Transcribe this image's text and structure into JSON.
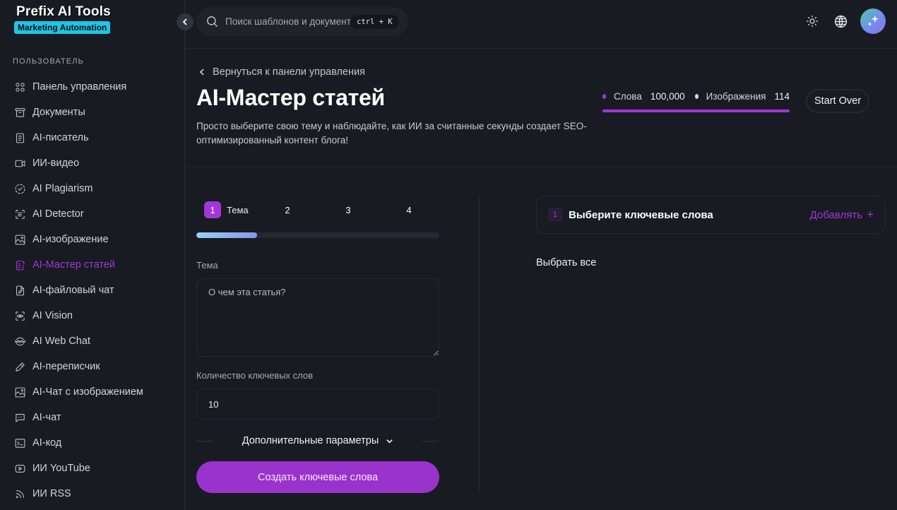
{
  "brand": {
    "title": "Prefix AI Tools",
    "badge": "Marketing Automation",
    "badge_color": "#1ec5e6"
  },
  "sidebar": {
    "section_label": "ПОЛЬЗОВАТЕЛЬ",
    "items": [
      {
        "label": "Панель управления",
        "icon": "dashboard-grid-icon",
        "active": false
      },
      {
        "label": "Документы",
        "icon": "archive-box-icon",
        "active": false
      },
      {
        "label": "AI-писатель",
        "icon": "document-text-icon",
        "active": false
      },
      {
        "label": "ИИ-видео",
        "icon": "video-camera-icon",
        "active": false
      },
      {
        "label": "AI Plagiarism",
        "icon": "dashed-check-circle-icon",
        "active": false
      },
      {
        "label": "AI Detector",
        "icon": "scan-text-icon",
        "active": false
      },
      {
        "label": "AI-изображение",
        "icon": "image-icon",
        "active": false
      },
      {
        "label": "AI-Мастер статей",
        "icon": "article-wizard-icon",
        "active": true
      },
      {
        "label": "AI-файловый чат",
        "icon": "file-edit-icon",
        "active": false
      },
      {
        "label": "AI Vision",
        "icon": "scan-eye-icon",
        "active": false
      },
      {
        "label": "AI Web Chat",
        "icon": "www-globe-icon",
        "active": false
      },
      {
        "label": "AI-переписчик",
        "icon": "pencil-icon",
        "active": false
      },
      {
        "label": "AI-Чат с изображением",
        "icon": "image-chat-icon",
        "active": false
      },
      {
        "label": "AI-чат",
        "icon": "chat-bubble-icon",
        "active": false
      },
      {
        "label": "AI-код",
        "icon": "terminal-icon",
        "active": false
      },
      {
        "label": "ИИ YouTube",
        "icon": "youtube-play-icon",
        "active": false
      },
      {
        "label": "ИИ RSS",
        "icon": "rss-icon",
        "active": false
      }
    ]
  },
  "topbar": {
    "search_placeholder": "Поиск шаблонов и документов...",
    "shortcut": "ctrl + K",
    "icons": [
      "sun-icon",
      "globe-icon",
      "sparkles-avatar-icon"
    ]
  },
  "page": {
    "back_label": "Вернуться к панели управления",
    "title": "AI-Мастер статей",
    "description": "Просто выберите свою тему и наблюдайте, как ИИ за считанные секунды создает SEO-оптимизированный контент блога!",
    "start_over": "Start Over"
  },
  "usage": {
    "words_label": "Слова",
    "words_value": "100,000",
    "words_color": "#a236d6",
    "images_label": "Изображения",
    "images_value": "114",
    "images_color": "#e3d3ee",
    "bar_fill_percent": 100
  },
  "wizard": {
    "steps": [
      {
        "num": "1",
        "label": "Тема",
        "active": true
      },
      {
        "num": "2",
        "label": "",
        "active": false
      },
      {
        "num": "3",
        "label": "",
        "active": false
      },
      {
        "num": "4",
        "label": "",
        "active": false
      }
    ],
    "progress_percent": 25,
    "topic_label": "Тема",
    "topic_placeholder": "О чем эта статья?",
    "topic_value": "",
    "keywords_count_label": "Количество ключевых слов",
    "keywords_count_value": "10",
    "advanced_label": "Дополнительные параметры",
    "generate_label": "Создать ключевые слова"
  },
  "keywords_panel": {
    "step_num": "1",
    "title": "Выберите ключевые слова",
    "add_label": "Добавлять",
    "add_symbol": "+",
    "select_all": "Выбрать все"
  },
  "colors": {
    "accent": "#a236d6",
    "background": "#181b22"
  }
}
